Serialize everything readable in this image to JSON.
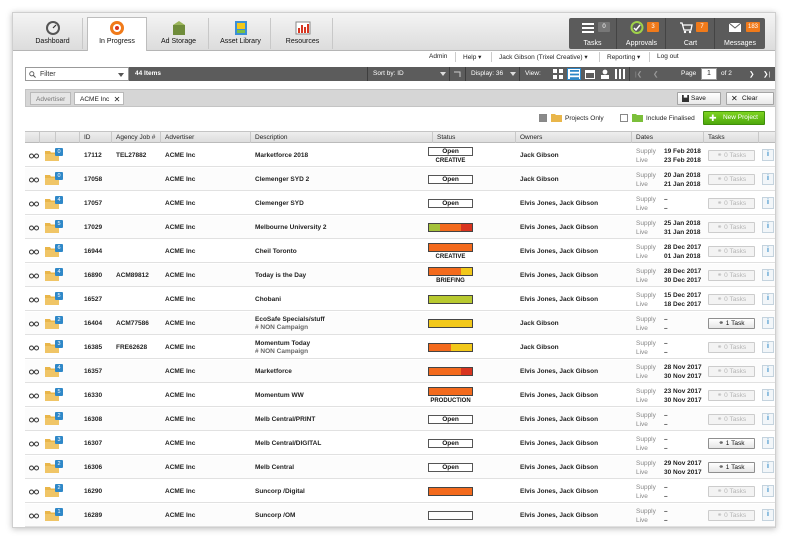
{
  "nav": {
    "tabs": [
      {
        "label": "Dashboard",
        "icon": "dashboard-icon",
        "active": false
      },
      {
        "label": "In Progress",
        "icon": "in-progress-icon",
        "active": true
      },
      {
        "label": "Ad Storage",
        "icon": "ad-storage-icon",
        "active": false
      },
      {
        "label": "Asset Library",
        "icon": "asset-library-icon",
        "active": false
      },
      {
        "label": "Resources",
        "icon": "resources-icon",
        "active": false
      }
    ],
    "right": [
      {
        "label": "Tasks",
        "count": "0",
        "count_color": "#777777",
        "icon": "tasks-icon"
      },
      {
        "label": "Approvals",
        "count": "3",
        "count_color": "#f07a1a",
        "icon": "approvals-icon"
      },
      {
        "label": "Cart",
        "count": "7",
        "count_color": "#f07a1a",
        "icon": "cart-icon"
      },
      {
        "label": "Messages",
        "count": "183",
        "count_color": "#f07a1a",
        "icon": "messages-icon"
      }
    ]
  },
  "admin": {
    "admin": "Admin",
    "help": "Help",
    "user": "Jack Gibson (Trixel Creative)",
    "reporting": "Reporting",
    "logout": "Log out"
  },
  "filterbar": {
    "filter_label": "Filter",
    "items": "44 Items",
    "sort_by": "Sort by: ID",
    "display": "Display: 36",
    "view": "View:",
    "page_label": "Page",
    "page_value": "1",
    "page_of": "of 2"
  },
  "tagbar": {
    "advertiser": "Advertiser",
    "acme": "ACME Inc",
    "save": "Save",
    "clear": "Clear"
  },
  "options": {
    "projects_only": "Projects Only",
    "include_finalised": "Include Finalised",
    "new_project": "New Project"
  },
  "columns": [
    "ID",
    "Agency Job #",
    "Advertiser",
    "Description",
    "Status",
    "Owners",
    "Dates",
    "Tasks"
  ],
  "date_labels": {
    "supply": "Supply",
    "live": "Live"
  },
  "status_colors": {
    "red": "#d8341f",
    "orange": "#f36a1d",
    "yellow": "#f2c81a",
    "green": "#a5c13a",
    "lime": "#b8c92f"
  },
  "rows": [
    {
      "id": "17112",
      "job": "TEL27882",
      "adv": "ACME Inc",
      "desc": "Marketforce 2018",
      "desc2": "",
      "status_type": "open",
      "status_text": "Open",
      "status_sub": "CREATIVE",
      "bar": [],
      "owners": "Jack Gibson",
      "supply": "19 Feb 2018",
      "live": "23 Feb 2018",
      "tasks": "0 Tasks",
      "tasks_active": false,
      "badge": "0"
    },
    {
      "id": "17058",
      "job": "",
      "adv": "ACME Inc",
      "desc": "Clemenger SYD 2",
      "desc2": "",
      "status_type": "open",
      "status_text": "Open",
      "status_sub": "",
      "bar": [],
      "owners": "Jack Gibson",
      "supply": "20 Jan 2018",
      "live": "21 Jan 2018",
      "tasks": "0 Tasks",
      "tasks_active": false,
      "badge": "0"
    },
    {
      "id": "17057",
      "job": "",
      "adv": "ACME Inc",
      "desc": "Clemenger SYD",
      "desc2": "",
      "status_type": "open",
      "status_text": "Open",
      "status_sub": "",
      "bar": [],
      "owners": "Elvis Jones, Jack Gibson",
      "supply": "–",
      "live": "–",
      "tasks": "0 Tasks",
      "tasks_active": false,
      "badge": "4"
    },
    {
      "id": "17029",
      "job": "",
      "adv": "ACME Inc",
      "desc": "Melbourne University 2",
      "desc2": "",
      "status_type": "bar",
      "status_text": "",
      "status_sub": "",
      "bar": [
        "green",
        "orange",
        "orange",
        "red"
      ],
      "owners": "Elvis Jones, Jack Gibson",
      "supply": "25 Jan 2018",
      "live": "31 Jan 2018",
      "tasks": "0 Tasks",
      "tasks_active": false,
      "badge": "5"
    },
    {
      "id": "16944",
      "job": "",
      "adv": "ACME Inc",
      "desc": "Cheil Toronto",
      "desc2": "",
      "status_type": "bar",
      "status_text": "",
      "status_sub": "CREATIVE",
      "bar": [
        "orange",
        "orange",
        "orange",
        "orange"
      ],
      "owners": "Elvis Jones, Jack Gibson",
      "supply": "28 Dec 2017",
      "live": "01 Jan 2018",
      "tasks": "0 Tasks",
      "tasks_active": false,
      "badge": "6"
    },
    {
      "id": "16890",
      "job": "ACM89812",
      "adv": "ACME Inc",
      "desc": "Today is the Day",
      "desc2": "",
      "status_type": "bar",
      "status_text": "",
      "status_sub": "BRIEFING",
      "bar": [
        "orange",
        "orange",
        "orange",
        "yellow"
      ],
      "owners": "Elvis Jones, Jack Gibson",
      "supply": "28 Dec 2017",
      "live": "30 Dec 2017",
      "tasks": "0 Tasks",
      "tasks_active": false,
      "badge": "4"
    },
    {
      "id": "16527",
      "job": "",
      "adv": "ACME Inc",
      "desc": "Chobani",
      "desc2": "",
      "status_type": "bar",
      "status_text": "",
      "status_sub": "",
      "bar": [
        "lime",
        "lime",
        "lime",
        "lime"
      ],
      "owners": "Elvis Jones, Jack Gibson",
      "supply": "15 Dec 2017",
      "live": "18 Dec 2017",
      "tasks": "0 Tasks",
      "tasks_active": false,
      "badge": "5"
    },
    {
      "id": "16404",
      "job": "ACM77586",
      "adv": "ACME Inc",
      "desc": "EcoSafe Specials/stuff",
      "desc2": "# NON Campaign",
      "status_type": "bar",
      "status_text": "",
      "status_sub": "",
      "bar": [
        "yellow",
        "yellow",
        "yellow",
        "yellow"
      ],
      "owners": "Jack Gibson",
      "supply": "–",
      "live": "–",
      "tasks": "1 Task",
      "tasks_active": true,
      "badge": "2"
    },
    {
      "id": "16385",
      "job": "FRE62628",
      "adv": "ACME Inc",
      "desc": "Momentum Today",
      "desc2": "# NON Campaign",
      "status_type": "bar",
      "status_text": "",
      "status_sub": "",
      "bar": [
        "orange",
        "orange",
        "yellow",
        "yellow"
      ],
      "owners": "Jack Gibson",
      "supply": "–",
      "live": "–",
      "tasks": "0 Tasks",
      "tasks_active": false,
      "badge": "3"
    },
    {
      "id": "16357",
      "job": "",
      "adv": "ACME Inc",
      "desc": "Marketforce",
      "desc2": "",
      "status_type": "bar",
      "status_text": "",
      "status_sub": "",
      "bar": [
        "orange",
        "orange",
        "orange",
        "red"
      ],
      "owners": "Elvis Jones, Jack Gibson",
      "supply": "28 Nov 2017",
      "live": "30 Nov 2017",
      "tasks": "0 Tasks",
      "tasks_active": false,
      "badge": "4"
    },
    {
      "id": "16330",
      "job": "",
      "adv": "ACME Inc",
      "desc": "Momentum WW",
      "desc2": "",
      "status_type": "bar",
      "status_text": "",
      "status_sub": "PRODUCTION",
      "bar": [
        "orange",
        "orange",
        "orange",
        "orange"
      ],
      "owners": "Elvis Jones, Jack Gibson",
      "supply": "23 Nov 2017",
      "live": "30 Nov 2017",
      "tasks": "0 Tasks",
      "tasks_active": false,
      "badge": "5"
    },
    {
      "id": "16308",
      "job": "",
      "adv": "ACME Inc",
      "desc": "Melb Central/PRINT",
      "desc2": "",
      "status_type": "open",
      "status_text": "Open",
      "status_sub": "",
      "bar": [],
      "owners": "Elvis Jones, Jack Gibson",
      "supply": "–",
      "live": "–",
      "tasks": "0 Tasks",
      "tasks_active": false,
      "badge": "2"
    },
    {
      "id": "16307",
      "job": "",
      "adv": "ACME Inc",
      "desc": "Melb Central/DIGITAL",
      "desc2": "",
      "status_type": "open",
      "status_text": "Open",
      "status_sub": "",
      "bar": [],
      "owners": "Elvis Jones, Jack Gibson",
      "supply": "–",
      "live": "–",
      "tasks": "1 Task",
      "tasks_active": true,
      "badge": "3"
    },
    {
      "id": "16306",
      "job": "",
      "adv": "ACME Inc",
      "desc": "Melb Central",
      "desc2": "",
      "status_type": "open",
      "status_text": "Open",
      "status_sub": "",
      "bar": [],
      "owners": "Elvis Jones, Jack Gibson",
      "supply": "29 Nov 2017",
      "live": "30 Nov 2017",
      "tasks": "1 Task",
      "tasks_active": true,
      "badge": "2"
    },
    {
      "id": "16290",
      "job": "",
      "adv": "ACME Inc",
      "desc": "Suncorp /Digital",
      "desc2": "",
      "status_type": "bar",
      "status_text": "",
      "status_sub": "",
      "bar": [
        "orange",
        "orange",
        "orange",
        "orange"
      ],
      "owners": "Elvis Jones, Jack Gibson",
      "supply": "–",
      "live": "–",
      "tasks": "0 Tasks",
      "tasks_active": false,
      "badge": "2"
    },
    {
      "id": "16289",
      "job": "",
      "adv": "ACME Inc",
      "desc": "Suncorp /OM",
      "desc2": "",
      "status_type": "open",
      "status_text": "",
      "status_sub": "",
      "bar": [],
      "owners": "Elvis Jones, Jack Gibson",
      "supply": "–",
      "live": "–",
      "tasks": "0 Tasks",
      "tasks_active": false,
      "badge": "1"
    }
  ]
}
